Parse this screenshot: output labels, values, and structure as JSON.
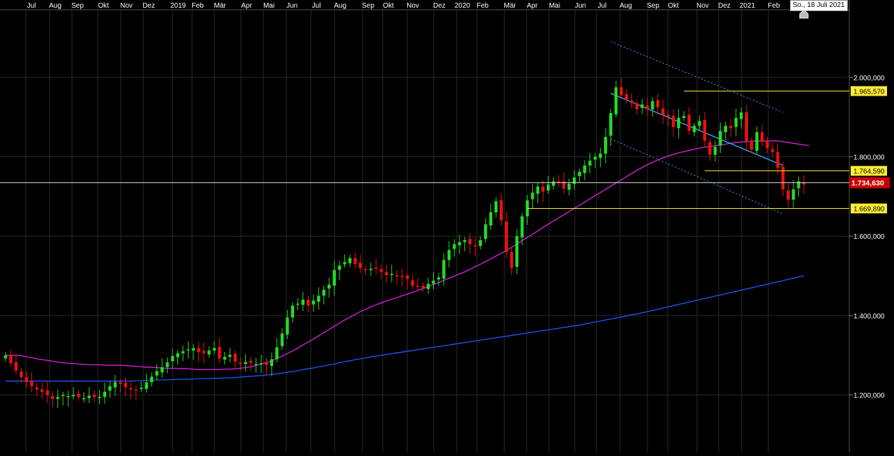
{
  "date_badge": "So., 18 Juli 2021",
  "colors": {
    "background": "#000000",
    "grid": "#2a2a2a",
    "up": "#22dd22",
    "down": "#ee1111",
    "ma_short": "#dd22dd",
    "ma_long": "#2255ff",
    "channel": "#33aaff",
    "level_line": "#ffee33",
    "level_label_bg": "#ffee33",
    "current_label_bg": "#cc0000",
    "axis_text": "#ffffff"
  },
  "chart_data": {
    "type": "candlestick",
    "x_tick_labels": [
      "Jul",
      "Aug",
      "Sep",
      "Okt",
      "Nov",
      "Dez",
      "2019",
      "Feb",
      "Mär",
      "Apr",
      "Mai",
      "Jun",
      "Jul",
      "Aug",
      "Sep",
      "Okt",
      "Nov",
      "Dez",
      "2020",
      "Feb",
      "Mär",
      "Apr",
      "Mai",
      "Jun",
      "Jul",
      "Aug",
      "Sep",
      "Okt",
      "Nov",
      "Dez",
      "2021",
      "Feb"
    ],
    "y_ticks": [
      1200000,
      1400000,
      1600000,
      1800000,
      2000000
    ],
    "y_tick_labels": [
      "1.200,000",
      "1.400,000",
      "1.600,000",
      "1.800,000",
      "2.000,000"
    ],
    "ylim": [
      1055000,
      2195000
    ],
    "grid": true,
    "current_price": {
      "value": 1734630,
      "label": "1.734,630"
    },
    "levels": [
      {
        "value": 1965570,
        "label": "1.965,570",
        "from_week": 130
      },
      {
        "value": 1764590,
        "label": "1.764,590",
        "from_week": 134
      },
      {
        "value": 1669890,
        "label": "1.669,890",
        "from_week": 100
      }
    ],
    "close": [
      1300000,
      1280000,
      1262000,
      1245000,
      1232000,
      1222000,
      1214000,
      1208000,
      1200000,
      1190000,
      1195000,
      1200000,
      1197000,
      1200000,
      1195000,
      1192000,
      1198000,
      1195000,
      1195000,
      1208000,
      1222000,
      1232000,
      1228000,
      1220000,
      1214000,
      1212000,
      1218000,
      1232000,
      1246000,
      1260000,
      1270000,
      1282000,
      1298000,
      1305000,
      1310000,
      1315000,
      1318000,
      1308000,
      1305000,
      1312000,
      1318000,
      1292000,
      1296000,
      1301000,
      1284000,
      1278000,
      1283000,
      1281000,
      1278000,
      1280000,
      1276000,
      1290000,
      1320000,
      1355000,
      1395000,
      1425000,
      1430000,
      1440000,
      1425000,
      1438000,
      1450000,
      1465000,
      1478000,
      1515000,
      1526000,
      1535000,
      1545000,
      1530000,
      1520000,
      1515000,
      1518000,
      1520000,
      1510000,
      1502000,
      1505000,
      1500000,
      1498000,
      1492000,
      1475000,
      1472000,
      1470000,
      1480000,
      1488000,
      1496000,
      1540000,
      1565000,
      1580000,
      1585000,
      1590000,
      1580000,
      1575000,
      1590000,
      1630000,
      1660000,
      1688000,
      1640000,
      1560000,
      1520000,
      1600000,
      1650000,
      1690000,
      1710000,
      1725000,
      1712000,
      1730000,
      1738000,
      1735000,
      1720000,
      1732000,
      1748000,
      1762000,
      1778000,
      1790000,
      1800000,
      1808000,
      1850000,
      1910000,
      1975000,
      1955000,
      1945000,
      1935000,
      1920000,
      1932000,
      1920000,
      1940000,
      1925000,
      1905000,
      1900000,
      1875000,
      1898000,
      1903000,
      1865000,
      1878000,
      1890000,
      1840000,
      1805000,
      1825000,
      1865000,
      1878000,
      1872000,
      1898000,
      1912000,
      1838000,
      1818000,
      1862000,
      1838000,
      1822000,
      1812000,
      1772000,
      1718000,
      1692000,
      1718000,
      1738000,
      1730000
    ],
    "ma_short": {
      "name": "",
      "values": [
        1300000,
        1300000,
        1300000,
        1299000,
        1296000,
        1294000,
        1291000,
        1289000,
        1287000,
        1285000,
        1283000,
        1281000,
        1280000,
        1279000,
        1278000,
        1277000,
        1276000,
        1276000,
        1276000,
        1275000,
        1275000,
        1275000,
        1275000,
        1274000,
        1273000,
        1272000,
        1271000,
        1270000,
        1270000,
        1269000,
        1268000,
        1267000,
        1267000,
        1267000,
        1266000,
        1266000,
        1265000,
        1264000,
        1264000,
        1264000,
        1264000,
        1264000,
        1265000,
        1265000,
        1266000,
        1267000,
        1269000,
        1271000,
        1274000,
        1278000,
        1282000,
        1286000,
        1292000,
        1298000,
        1304000,
        1311000,
        1318000,
        1326000,
        1333000,
        1341000,
        1349000,
        1357000,
        1365000,
        1373000,
        1381000,
        1389000,
        1396000,
        1403000,
        1410000,
        1416000,
        1422000,
        1427000,
        1432000,
        1437000,
        1441000,
        1445000,
        1450000,
        1454000,
        1459000,
        1463000,
        1468000,
        1473000,
        1478000,
        1483000,
        1489000,
        1494000,
        1499000,
        1505000,
        1510000,
        1516000,
        1523000,
        1529000,
        1536000,
        1543000,
        1550000,
        1557000,
        1564000,
        1572000,
        1580000,
        1589000,
        1597000,
        1605000,
        1613000,
        1622000,
        1630000,
        1638000,
        1646000,
        1654000,
        1662000,
        1670000,
        1678000,
        1686000,
        1694000,
        1702000,
        1710000,
        1718000,
        1726000,
        1734000,
        1742000,
        1750000,
        1758000,
        1766000,
        1773000,
        1780000,
        1786000,
        1792000,
        1797000,
        1802000,
        1806000,
        1810000,
        1813000,
        1816000,
        1819000,
        1822000,
        1824000,
        1826000,
        1828000,
        1830000,
        1832000,
        1834000,
        1836000,
        1837000,
        1838000,
        1839000,
        1840000,
        1840000,
        1840000,
        1840000,
        1840000,
        1838000,
        1836000,
        1834000,
        1832000,
        1830000,
        1828000
      ]
    },
    "ma_long": {
      "name": "",
      "values": [
        1235000,
        1235000,
        1235000,
        1235000,
        1235000,
        1235000,
        1235000,
        1235000,
        1235000,
        1235000,
        1235000,
        1235000,
        1235000,
        1235000,
        1235000,
        1235000,
        1235000,
        1235000,
        1235000,
        1235000,
        1235000,
        1235000,
        1235000,
        1235000,
        1235000,
        1236000,
        1236000,
        1237000,
        1237000,
        1238000,
        1238000,
        1238000,
        1239000,
        1239000,
        1240000,
        1240000,
        1240000,
        1241000,
        1241000,
        1241000,
        1242000,
        1242000,
        1243000,
        1243000,
        1244000,
        1245000,
        1246000,
        1247000,
        1248000,
        1249000,
        1250000,
        1252000,
        1253000,
        1255000,
        1257000,
        1259000,
        1261000,
        1264000,
        1266000,
        1268000,
        1271000,
        1273000,
        1276000,
        1278000,
        1281000,
        1284000,
        1286000,
        1289000,
        1291000,
        1293000,
        1296000,
        1298000,
        1300000,
        1302000,
        1304000,
        1306000,
        1308000,
        1310000,
        1312000,
        1314000,
        1316000,
        1318000,
        1320000,
        1322000,
        1324000,
        1326000,
        1328000,
        1330000,
        1332000,
        1334000,
        1336000,
        1338000,
        1340000,
        1342000,
        1344000,
        1346000,
        1348000,
        1350000,
        1352000,
        1354000,
        1356000,
        1358000,
        1360000,
        1362000,
        1364000,
        1366000,
        1368000,
        1370000,
        1372000,
        1374000,
        1376000,
        1379000,
        1381000,
        1384000,
        1386000,
        1389000,
        1391000,
        1394000,
        1396000,
        1399000,
        1402000,
        1404000,
        1407000,
        1410000,
        1413000,
        1416000,
        1419000,
        1422000,
        1425000,
        1428000,
        1431000,
        1434000,
        1437000,
        1440000,
        1443000,
        1446000,
        1449000,
        1452000,
        1455000,
        1458000,
        1461000,
        1464000,
        1467000,
        1470000,
        1473000,
        1476000,
        1479000,
        1482000,
        1485000,
        1488000,
        1491000,
        1494000,
        1497000,
        1500000
      ]
    },
    "trend_channel": {
      "middle": {
        "w1": 116,
        "v1": 1960000,
        "w2": 149,
        "v2": 1778000
      },
      "upper": {
        "w1": 116,
        "v1": 2090000,
        "w2": 149,
        "v2": 1912000
      },
      "lower": {
        "w1": 116,
        "v1": 1845000,
        "w2": 149,
        "v2": 1656000
      }
    }
  }
}
